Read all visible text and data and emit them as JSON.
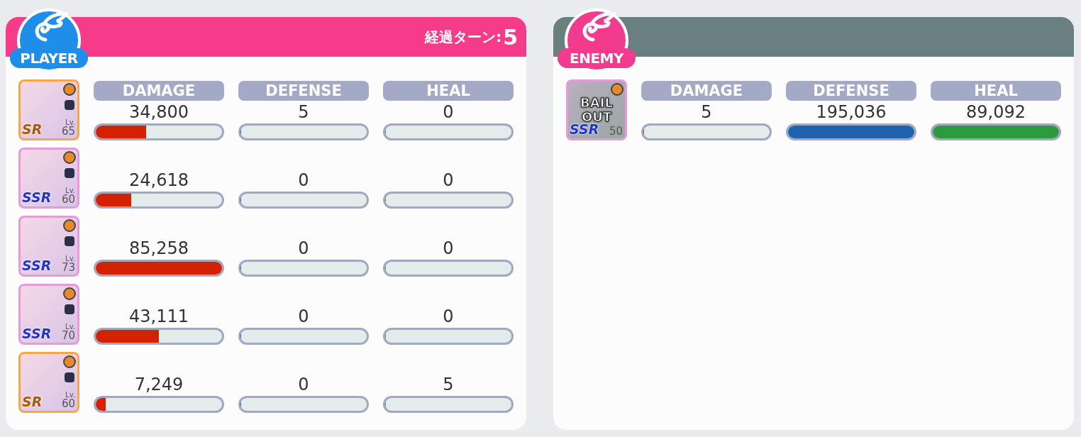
{
  "panels": [
    {
      "kind": "player",
      "badge": "PLAYER",
      "turn_label": "経過ターン:",
      "turn_value": "5",
      "columns": [
        "DAMAGE",
        "DEFENSE",
        "HEAL"
      ],
      "units": [
        {
          "rarity": "SR",
          "level_label": "Lv.",
          "level": "65",
          "defeated": false,
          "stats": [
            {
              "kind": "damage",
              "value": "34,800",
              "level": 0.4
            },
            {
              "kind": "defense",
              "value": "5",
              "level": 0
            },
            {
              "kind": "heal",
              "value": "0",
              "level": 0
            }
          ]
        },
        {
          "rarity": "SSR",
          "level_label": "Lv.",
          "level": "60",
          "defeated": false,
          "stats": [
            {
              "kind": "damage",
              "value": "24,618",
              "level": 0.28
            },
            {
              "kind": "defense",
              "value": "0",
              "level": 0
            },
            {
              "kind": "heal",
              "value": "0",
              "level": 0
            }
          ]
        },
        {
          "rarity": "SSR",
          "level_label": "Lv.",
          "level": "73",
          "defeated": false,
          "stats": [
            {
              "kind": "damage",
              "value": "85,258",
              "level": 1
            },
            {
              "kind": "defense",
              "value": "0",
              "level": 0
            },
            {
              "kind": "heal",
              "value": "0",
              "level": 0
            }
          ]
        },
        {
          "rarity": "SSR",
          "level_label": "Lv.",
          "level": "70",
          "defeated": false,
          "stats": [
            {
              "kind": "damage",
              "value": "43,111",
              "level": 0.5
            },
            {
              "kind": "defense",
              "value": "0",
              "level": 0
            },
            {
              "kind": "heal",
              "value": "0",
              "level": 0
            }
          ]
        },
        {
          "rarity": "SR",
          "level_label": "Lv.",
          "level": "60",
          "defeated": false,
          "stats": [
            {
              "kind": "damage",
              "value": "7,249",
              "level": 0.08
            },
            {
              "kind": "defense",
              "value": "0",
              "level": 0
            },
            {
              "kind": "heal",
              "value": "5",
              "level": 0
            }
          ]
        }
      ]
    },
    {
      "kind": "enemy",
      "badge": "ENEMY",
      "columns": [
        "DAMAGE",
        "DEFENSE",
        "HEAL"
      ],
      "units": [
        {
          "rarity": "SSR",
          "level": "50",
          "defeated": true,
          "status": "BAIL OUT",
          "stats": [
            {
              "kind": "damage",
              "value": "5",
              "level": 0
            },
            {
              "kind": "defense",
              "value": "195,036",
              "level": 1
            },
            {
              "kind": "heal",
              "value": "89,092",
              "level": 1
            }
          ]
        }
      ]
    }
  ]
}
